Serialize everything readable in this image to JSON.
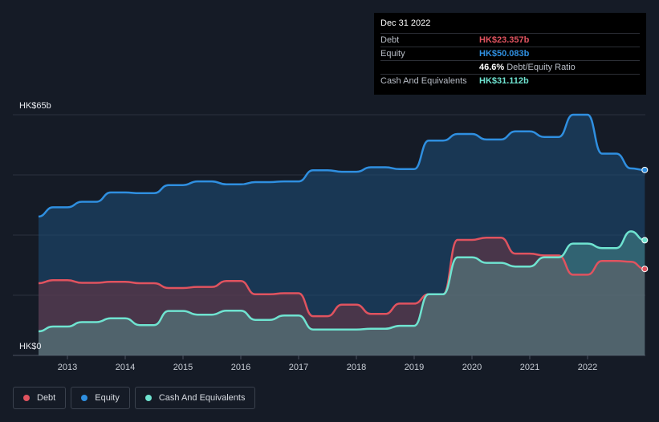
{
  "chart_data": {
    "type": "area",
    "ylim": [
      0,
      65
    ],
    "y_tick_labels": [
      "HK$0",
      "HK$65b"
    ],
    "x_tick_labels": [
      "2013",
      "2014",
      "2015",
      "2016",
      "2017",
      "2018",
      "2019",
      "2020",
      "2021",
      "2022"
    ],
    "x_range": [
      2012.5,
      2023.0
    ],
    "grid": true,
    "legend_position": "bottom-left",
    "series": [
      {
        "name": "Equity",
        "color": "#2f8fe0",
        "points": [
          [
            2012.5,
            37.5
          ],
          [
            2012.75,
            40.0
          ],
          [
            2013.0,
            40.0
          ],
          [
            2013.25,
            41.5
          ],
          [
            2013.5,
            41.5
          ],
          [
            2013.75,
            44.0
          ],
          [
            2014.0,
            44.0
          ],
          [
            2014.25,
            43.8
          ],
          [
            2014.5,
            43.8
          ],
          [
            2014.75,
            46.0
          ],
          [
            2015.0,
            46.0
          ],
          [
            2015.25,
            47.0
          ],
          [
            2015.5,
            47.0
          ],
          [
            2015.75,
            46.2
          ],
          [
            2016.0,
            46.2
          ],
          [
            2016.25,
            46.8
          ],
          [
            2016.5,
            46.8
          ],
          [
            2016.75,
            47.0
          ],
          [
            2017.0,
            47.0
          ],
          [
            2017.25,
            50.0
          ],
          [
            2017.5,
            50.0
          ],
          [
            2017.75,
            49.6
          ],
          [
            2018.0,
            49.6
          ],
          [
            2018.25,
            50.8
          ],
          [
            2018.5,
            50.8
          ],
          [
            2018.75,
            50.3
          ],
          [
            2019.0,
            50.3
          ],
          [
            2019.25,
            58.0
          ],
          [
            2019.5,
            58.0
          ],
          [
            2019.75,
            59.8
          ],
          [
            2020.0,
            59.8
          ],
          [
            2020.25,
            58.3
          ],
          [
            2020.5,
            58.3
          ],
          [
            2020.75,
            60.5
          ],
          [
            2021.0,
            60.5
          ],
          [
            2021.25,
            59.0
          ],
          [
            2021.5,
            59.0
          ],
          [
            2021.75,
            65.0
          ],
          [
            2022.0,
            65.0
          ],
          [
            2022.25,
            54.5
          ],
          [
            2022.5,
            54.5
          ],
          [
            2022.75,
            50.5
          ],
          [
            2022.99,
            50.083
          ]
        ]
      },
      {
        "name": "Debt",
        "color": "#e0535f",
        "points": [
          [
            2012.5,
            19.5
          ],
          [
            2012.75,
            20.3
          ],
          [
            2013.0,
            20.3
          ],
          [
            2013.25,
            19.6
          ],
          [
            2013.5,
            19.6
          ],
          [
            2013.75,
            19.9
          ],
          [
            2014.0,
            19.9
          ],
          [
            2014.25,
            19.5
          ],
          [
            2014.5,
            19.5
          ],
          [
            2014.75,
            18.2
          ],
          [
            2015.0,
            18.2
          ],
          [
            2015.25,
            18.5
          ],
          [
            2015.5,
            18.5
          ],
          [
            2015.75,
            20.1
          ],
          [
            2016.0,
            20.1
          ],
          [
            2016.25,
            16.5
          ],
          [
            2016.5,
            16.5
          ],
          [
            2016.75,
            16.8
          ],
          [
            2017.0,
            16.8
          ],
          [
            2017.25,
            10.6
          ],
          [
            2017.5,
            10.6
          ],
          [
            2017.75,
            13.7
          ],
          [
            2018.0,
            13.7
          ],
          [
            2018.25,
            11.2
          ],
          [
            2018.5,
            11.2
          ],
          [
            2018.75,
            14.0
          ],
          [
            2019.0,
            14.0
          ],
          [
            2019.25,
            16.5
          ],
          [
            2019.5,
            16.5
          ],
          [
            2019.75,
            31.2
          ],
          [
            2020.0,
            31.2
          ],
          [
            2020.25,
            31.8
          ],
          [
            2020.5,
            31.8
          ],
          [
            2020.75,
            27.5
          ],
          [
            2021.0,
            27.5
          ],
          [
            2021.25,
            27.0
          ],
          [
            2021.5,
            27.0
          ],
          [
            2021.75,
            21.8
          ],
          [
            2022.0,
            21.8
          ],
          [
            2022.25,
            25.5
          ],
          [
            2022.5,
            25.5
          ],
          [
            2022.75,
            25.3
          ],
          [
            2022.99,
            23.357
          ]
        ]
      },
      {
        "name": "Cash And Equivalents",
        "color": "#6fe3d0",
        "points": [
          [
            2012.5,
            6.5
          ],
          [
            2012.75,
            7.8
          ],
          [
            2013.0,
            7.8
          ],
          [
            2013.25,
            9.0
          ],
          [
            2013.5,
            9.0
          ],
          [
            2013.75,
            10.0
          ],
          [
            2014.0,
            10.0
          ],
          [
            2014.25,
            8.2
          ],
          [
            2014.5,
            8.2
          ],
          [
            2014.75,
            12.0
          ],
          [
            2015.0,
            12.0
          ],
          [
            2015.25,
            11.0
          ],
          [
            2015.5,
            11.0
          ],
          [
            2015.75,
            12.1
          ],
          [
            2016.0,
            12.1
          ],
          [
            2016.25,
            9.6
          ],
          [
            2016.5,
            9.6
          ],
          [
            2016.75,
            10.8
          ],
          [
            2017.0,
            10.8
          ],
          [
            2017.25,
            7.0
          ],
          [
            2017.5,
            7.0
          ],
          [
            2017.75,
            7.0
          ],
          [
            2018.0,
            7.0
          ],
          [
            2018.25,
            7.2
          ],
          [
            2018.5,
            7.2
          ],
          [
            2018.75,
            8.0
          ],
          [
            2019.0,
            8.0
          ],
          [
            2019.25,
            16.5
          ],
          [
            2019.5,
            16.5
          ],
          [
            2019.75,
            26.5
          ],
          [
            2020.0,
            26.5
          ],
          [
            2020.25,
            25.0
          ],
          [
            2020.5,
            25.0
          ],
          [
            2020.75,
            24.0
          ],
          [
            2021.0,
            24.0
          ],
          [
            2021.25,
            26.5
          ],
          [
            2021.5,
            26.5
          ],
          [
            2021.75,
            30.2
          ],
          [
            2022.0,
            30.2
          ],
          [
            2022.25,
            29.0
          ],
          [
            2022.5,
            29.0
          ],
          [
            2022.75,
            33.5
          ],
          [
            2022.99,
            31.112
          ]
        ]
      }
    ]
  },
  "tooltip": {
    "date": "Dec 31 2022",
    "rows": [
      {
        "label": "Debt",
        "value": "HK$23.357b",
        "color": "#e0535f"
      },
      {
        "label": "Equity",
        "value": "HK$50.083b",
        "color": "#2f8fe0"
      },
      {
        "label": "",
        "value": "46.6%",
        "sub": "Debt/Equity Ratio",
        "color": "#ffffff"
      },
      {
        "label": "Cash And Equivalents",
        "value": "HK$31.112b",
        "color": "#6fe3d0"
      }
    ]
  },
  "legend": [
    {
      "label": "Debt",
      "color": "#e0535f"
    },
    {
      "label": "Equity",
      "color": "#2f8fe0"
    },
    {
      "label": "Cash And Equivalents",
      "color": "#6fe3d0"
    }
  ]
}
